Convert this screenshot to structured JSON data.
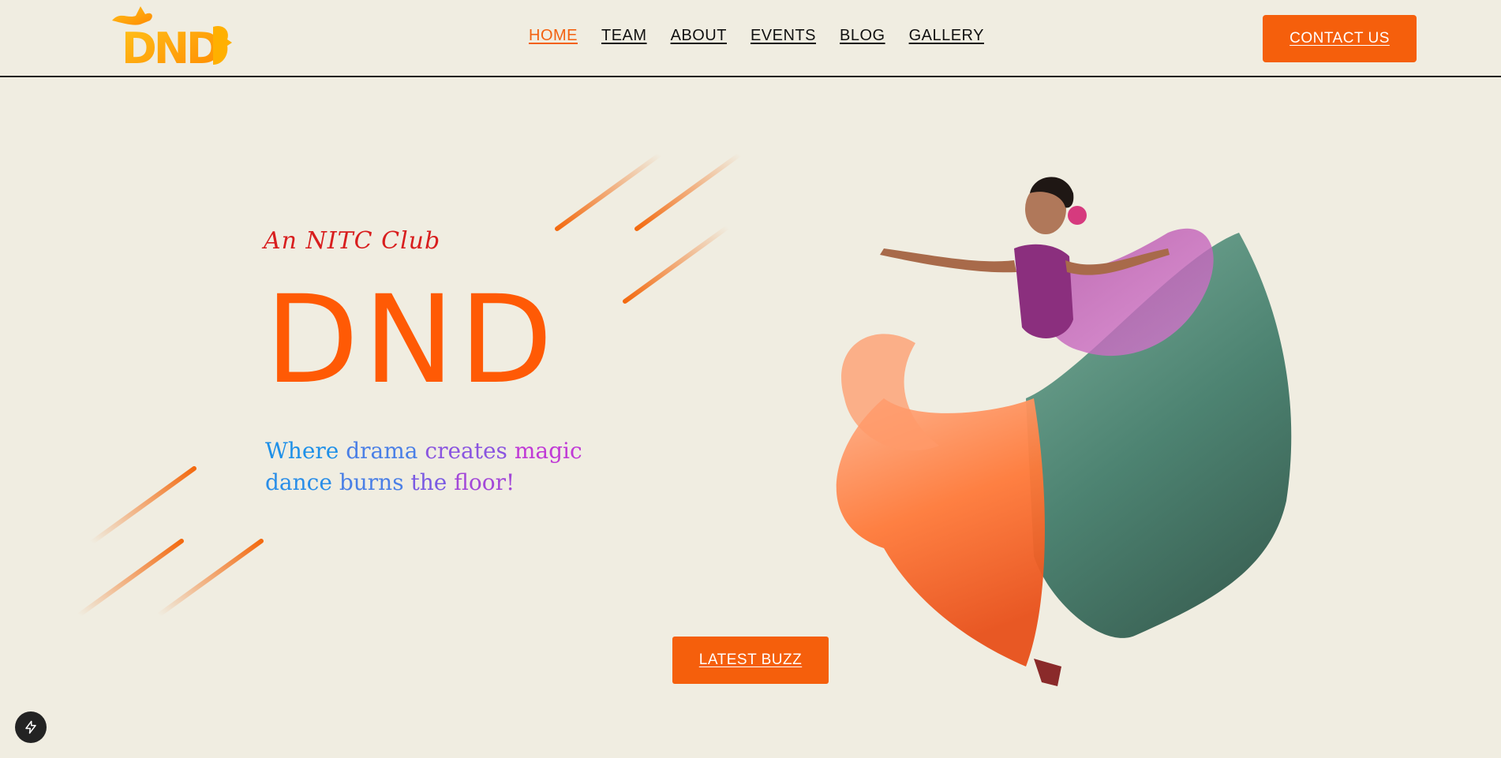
{
  "header": {
    "logo_text": "DND",
    "nav": [
      {
        "label": "HOME",
        "active": true
      },
      {
        "label": "TEAM",
        "active": false
      },
      {
        "label": "ABOUT",
        "active": false
      },
      {
        "label": "EVENTS",
        "active": false
      },
      {
        "label": "BLOG",
        "active": false
      },
      {
        "label": "GALLERY",
        "active": false
      }
    ],
    "contact_label": "CONTACT US"
  },
  "hero": {
    "tagline": "An NITC Club",
    "title": "DND",
    "motto_words": [
      {
        "text": "Where ",
        "color": "#1e90e8"
      },
      {
        "text": "drama ",
        "color": "#4a7fe6"
      },
      {
        "text": "creates ",
        "color": "#8a55e0"
      },
      {
        "text": "magic",
        "color": "#c03ad6"
      },
      {
        "text": " dance ",
        "color": "#2a8ee8"
      },
      {
        "text": "burns ",
        "color": "#4a7fe6"
      },
      {
        "text": "the ",
        "color": "#7a5ae2"
      },
      {
        "text": "floor!",
        "color": "#a348d8"
      }
    ],
    "buzz_label": "LATEST BUZZ"
  },
  "colors": {
    "accent": "#f55f0c",
    "background": "#f0ede1"
  },
  "icons": {
    "floating_button": "lightning-bolt-icon"
  }
}
